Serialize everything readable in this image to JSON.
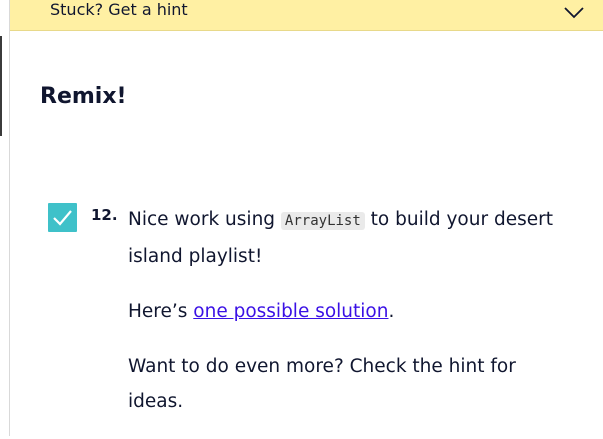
{
  "hint_bar": {
    "label": "Stuck? Get a hint",
    "chevron_icon": "chevron-down-icon"
  },
  "section": {
    "title": "Remix!"
  },
  "task": {
    "number": "12.",
    "completed": true,
    "checkbox_icon": "checkmark-icon",
    "line1_before": "Nice work using ",
    "line1_code": "ArrayList",
    "line1_after": " to build your desert island playlist!",
    "line2_before": "Here’s ",
    "line2_link": "one possible solution",
    "line2_after": ".",
    "line3": "Want to do even more? Check the hint for ideas."
  },
  "colors": {
    "hint_bar_bg": "#fff0a3",
    "checkbox_bg": "#3fc1c9",
    "link": "#3a10e5",
    "text": "#10162f"
  }
}
